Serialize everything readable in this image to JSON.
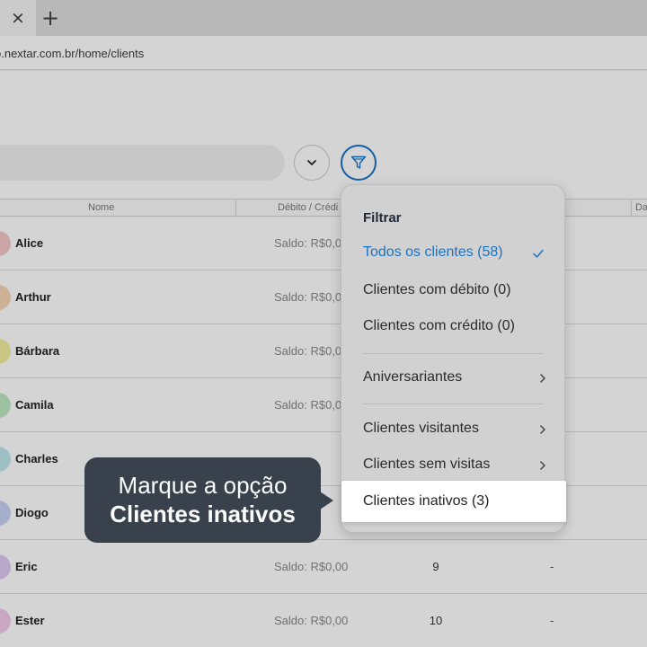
{
  "browser": {
    "tab_close": "×",
    "new_tab": "+",
    "url": "o.nextar.com.br/home/clients"
  },
  "table": {
    "columns": [
      "Nome",
      "Débito / Crédi",
      "Da"
    ],
    "rows": [
      {
        "name": "Alice",
        "saldo": "Saldo: R$0,0",
        "visits": "",
        "last": "",
        "avatar_color": "#f4c6c6"
      },
      {
        "name": "Arthur",
        "saldo": "Saldo: R$0,0",
        "visits": "",
        "last": "",
        "avatar_color": "#f6d7b4"
      },
      {
        "name": "Bárbara",
        "saldo": "Saldo: R$0,0",
        "visits": "",
        "last": "",
        "avatar_color": "#f1ef9a"
      },
      {
        "name": "Camila",
        "saldo": "Saldo: R$0,0",
        "visits": "",
        "last": "",
        "avatar_color": "#bfe8c3"
      },
      {
        "name": "Charles",
        "saldo": "",
        "visits": "",
        "last": "",
        "avatar_color": "#bfe6ec"
      },
      {
        "name": "Diogo",
        "saldo": "",
        "visits": "",
        "last": "",
        "avatar_color": "#c8d3f3"
      },
      {
        "name": "Eric",
        "saldo": "Saldo: R$0,00",
        "visits": "9",
        "last": "-",
        "avatar_color": "#dccbf3"
      },
      {
        "name": "Ester",
        "saldo": "Saldo: R$0,00",
        "visits": "10",
        "last": "-",
        "avatar_color": "#f2c9ea"
      }
    ]
  },
  "filter_menu": {
    "title": "Filtrar",
    "items": [
      {
        "label": "Todos os clientes (58)",
        "active": true
      },
      {
        "label": "Clientes com débito (0)"
      },
      {
        "label": "Clientes com crédito (0)"
      },
      {
        "label": "Aniversariantes"
      },
      {
        "label": "Clientes visitantes"
      },
      {
        "label": "Clientes sem visitas"
      },
      {
        "label": "Clientes inativos (3)"
      }
    ]
  },
  "callout": {
    "line1": "Marque a opção",
    "line2": "Clientes inativos"
  },
  "colors": {
    "accent": "#1a73c8",
    "callout_bg": "#38414c"
  },
  "icons": {
    "dropdown_toggle": "chevron-down-icon",
    "filter": "filter-icon",
    "selected": "check-icon",
    "submenu": "chevron-right-icon"
  }
}
